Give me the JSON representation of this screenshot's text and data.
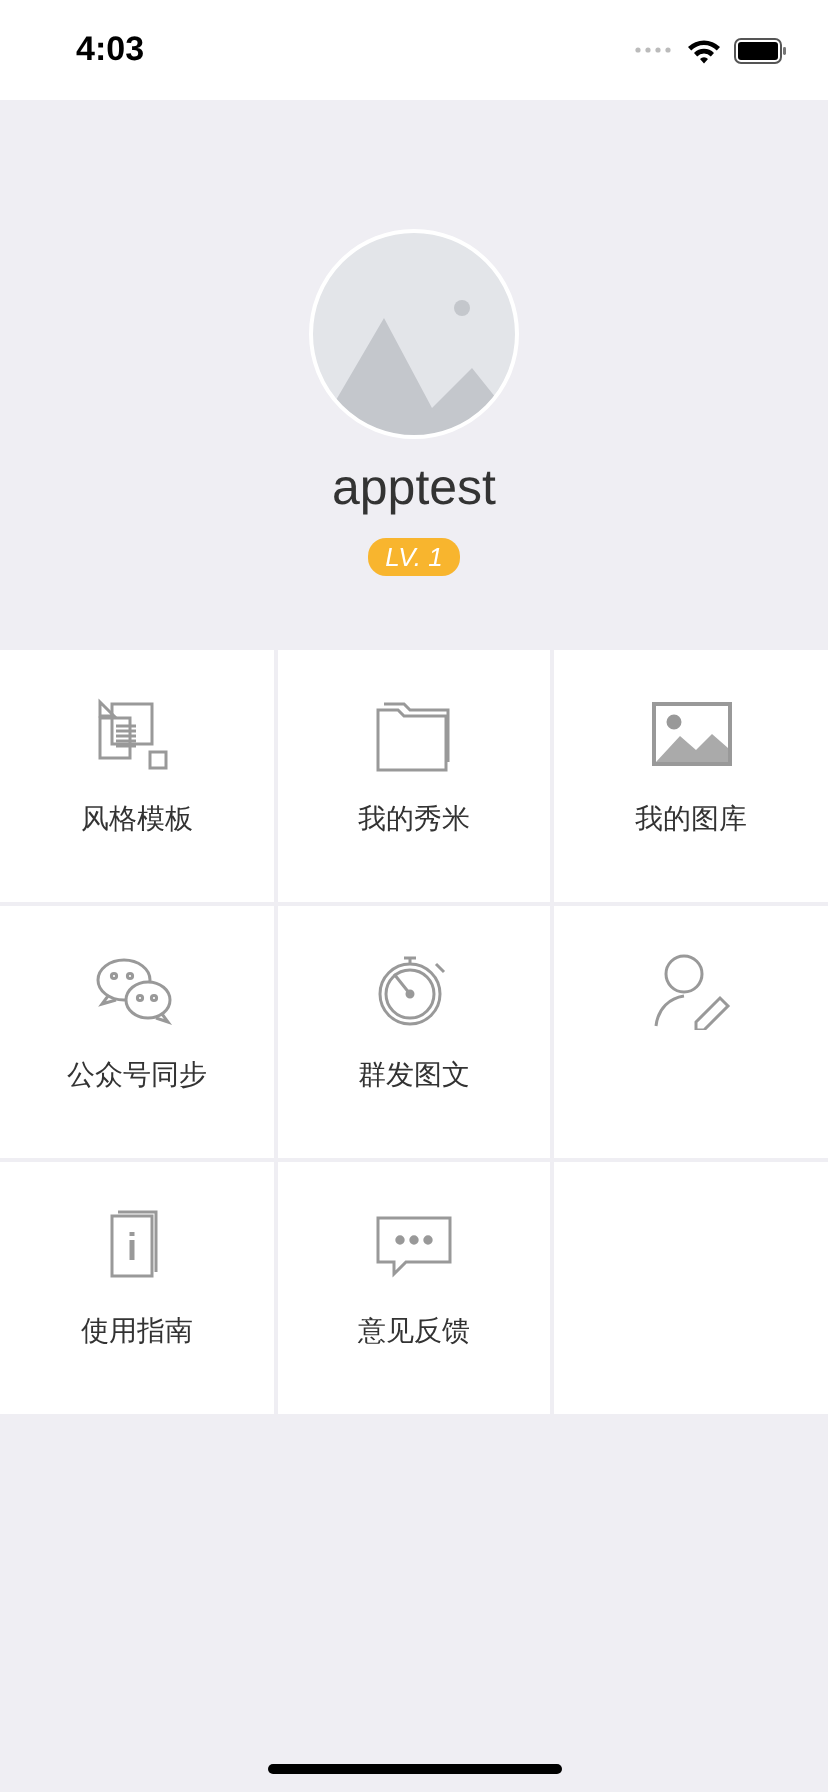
{
  "status_bar": {
    "time": "4:03"
  },
  "profile": {
    "username": "apptest",
    "level_badge": "LV. 1"
  },
  "menu": [
    {
      "kind": "template",
      "label": "风格模板"
    },
    {
      "kind": "folder",
      "label": "我的秀米"
    },
    {
      "kind": "gallery",
      "label": "我的图库"
    },
    {
      "kind": "chat",
      "label": "公众号同步"
    },
    {
      "kind": "stopwatch",
      "label": "群发图文"
    },
    {
      "kind": "user-edit"
    },
    {
      "kind": "guide",
      "label": "使用指南"
    },
    {
      "kind": "feedback",
      "label": "意见反馈"
    },
    {
      "kind": "empty"
    }
  ]
}
